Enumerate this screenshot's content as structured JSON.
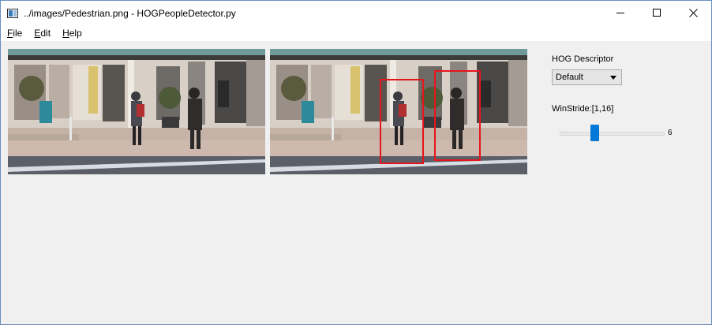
{
  "window": {
    "title": "../images/Pedestrian.png - HOGPeopleDetector.py",
    "controls": {
      "minimize": "minimize-icon",
      "maximize": "maximize-icon",
      "close": "close-icon"
    }
  },
  "menu": {
    "items": [
      {
        "label": "File",
        "access_key": "F",
        "rest": "ile"
      },
      {
        "label": "Edit",
        "access_key": "E",
        "rest": "dit"
      },
      {
        "label": "Help",
        "access_key": "H",
        "rest": "elp"
      }
    ]
  },
  "images": {
    "source": "pedestrian street photo",
    "result": "pedestrian street photo with two detection boxes",
    "detection_box_color": "#e8141c"
  },
  "panel": {
    "descriptor_label": "HOG Descriptor",
    "descriptor_value": "Default",
    "winstride_label": "WinStride:[1,16]",
    "slider_value": "6",
    "slider_range": [
      1,
      16
    ]
  },
  "colors": {
    "accent": "#0078d7",
    "window_bg": "#f0f0f0"
  }
}
